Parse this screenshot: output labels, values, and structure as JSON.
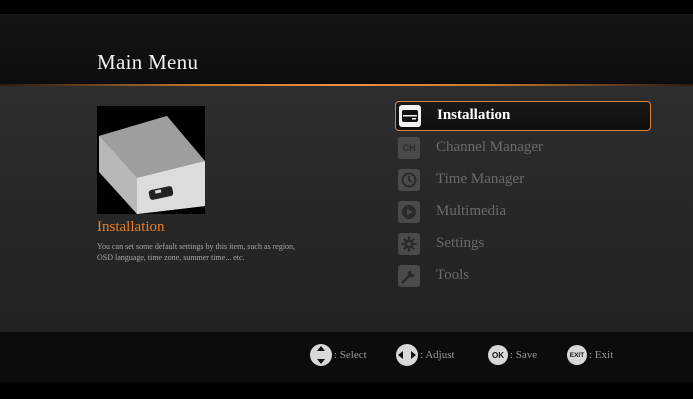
{
  "header": {
    "title": "Main Menu"
  },
  "preview": {
    "icon": "device-box-icon",
    "title": "Installation",
    "description": "You can set some default settings by this item, such as region, OSD language, time zone, summer time... etc."
  },
  "menu": {
    "selected_index": 0,
    "items": [
      {
        "label": "Installation",
        "icon": "installation-icon"
      },
      {
        "label": "Channel Manager",
        "icon": "channel-manager-icon"
      },
      {
        "label": "Time Manager",
        "icon": "clock-icon"
      },
      {
        "label": "Multimedia",
        "icon": "play-icon"
      },
      {
        "label": "Settings",
        "icon": "gear-icon"
      },
      {
        "label": "Tools",
        "icon": "wrench-icon"
      }
    ]
  },
  "footer": {
    "hints": [
      {
        "key": "",
        "label": ": Select",
        "icon": "up-down-arrows-icon"
      },
      {
        "key": "",
        "label": ": Adjust",
        "icon": "left-right-arrows-icon"
      },
      {
        "key": "OK",
        "label": ": Save",
        "icon": "ok-button-icon"
      },
      {
        "key": "EXIT",
        "label": ": Exit",
        "icon": "exit-button-icon"
      }
    ]
  },
  "colors": {
    "accent": "#e8802c",
    "selected_border": "#d9823a",
    "background": "#2a2a2a"
  }
}
